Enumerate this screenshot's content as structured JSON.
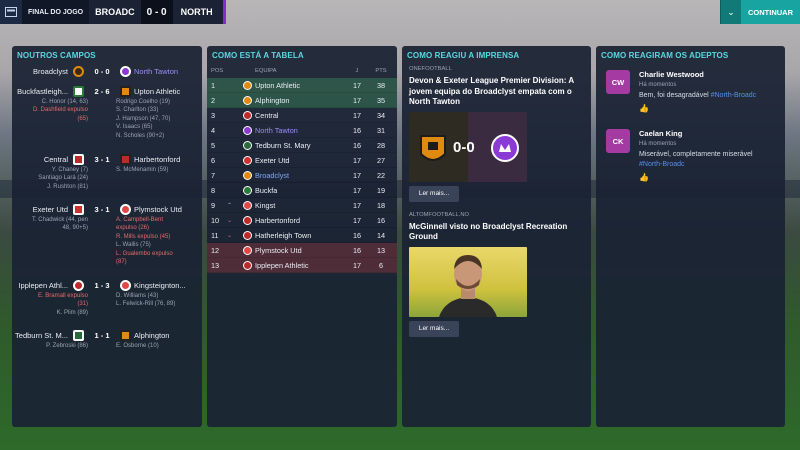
{
  "topbar": {
    "match_label": "FINAL DO JOGO",
    "home_team": "BROADC",
    "score": "0 - 0",
    "away_team": "NORTH",
    "continue_label": "CONTINUAR",
    "accent_color": "#7b2fd0",
    "continue_color": "#18a5a2"
  },
  "other_games": {
    "title": "NOUTROS CAMPOS",
    "matches": [
      {
        "home": "Broadclyst",
        "score": "0 - 0",
        "away": "North Tawton",
        "home_scorers": [],
        "away_scorers": []
      },
      {
        "home": "Buckfastleigh...",
        "score": "2 - 6",
        "away": "Upton Athletic",
        "home_scorers": [
          "C. Honor (14, 63)",
          "D. Dashfield expulso",
          "(65)"
        ],
        "away_scorers": [
          "Rodrigo Coelho (19)",
          "S. Charlton (33)",
          "J. Hampson (47, 70)",
          "V. Isaacs (65)",
          "N. Scholes (90+2)"
        ]
      },
      {
        "home": "Central",
        "score": "3 - 1",
        "away": "Harbertonford",
        "home_scorers": [
          "Y. Chaney (7)",
          "Santiago Lará (24)",
          "J. Rushton (81)"
        ],
        "away_scorers": [
          "S. McMenamin (59)"
        ]
      },
      {
        "home": "Exeter Utd",
        "score": "3 - 1",
        "away": "Plymstock Utd",
        "home_scorers": [
          "T. Chadwick (44, pen",
          "48, 90+5)"
        ],
        "away_scorers": [
          "A. Campbell-Bent",
          "expulso (26)",
          "R. Mills expulso (45)",
          "L. Wallis (75)",
          "L. Gualembo expulso",
          "(87)"
        ]
      },
      {
        "home": "Ipplepen Athl...",
        "score": "1 - 3",
        "away": "Kingsteignton...",
        "home_scorers": [
          "E. Bramall expulso",
          "(31)",
          "K. Plim (89)"
        ],
        "away_scorers": [
          "D. Williams (43)",
          "L. Felwick-Rill (76, 89)"
        ]
      },
      {
        "home": "Tedburn St. M...",
        "score": "1 - 1",
        "away": "Alphington",
        "home_scorers": [
          "P. Zebroski (86)"
        ],
        "away_scorers": [
          "E. Osborne (10)"
        ]
      }
    ]
  },
  "table": {
    "title": "COMO ESTÁ A TABELA",
    "headers": {
      "pos": "POS",
      "team": "EQUIPA",
      "j": "J",
      "pts": "PTS"
    },
    "rows": [
      {
        "pos": "1",
        "arrow": "",
        "team": "Upton Athletic",
        "j": "17",
        "pts": "38"
      },
      {
        "pos": "2",
        "arrow": "",
        "team": "Alphington",
        "j": "17",
        "pts": "35"
      },
      {
        "pos": "3",
        "arrow": "",
        "team": "Central",
        "j": "17",
        "pts": "34"
      },
      {
        "pos": "4",
        "arrow": "",
        "team": "North Tawton",
        "j": "16",
        "pts": "31"
      },
      {
        "pos": "5",
        "arrow": "",
        "team": "Tedburn St. Mary",
        "j": "16",
        "pts": "28"
      },
      {
        "pos": "6",
        "arrow": "",
        "team": "Exeter Utd",
        "j": "17",
        "pts": "27"
      },
      {
        "pos": "7",
        "arrow": "",
        "team": "Broadclyst",
        "j": "17",
        "pts": "22"
      },
      {
        "pos": "8",
        "arrow": "",
        "team": "Buckfa",
        "j": "17",
        "pts": "19"
      },
      {
        "pos": "9",
        "arrow": "^",
        "team": "Kingst",
        "j": "17",
        "pts": "18"
      },
      {
        "pos": "10",
        "arrow": "v",
        "team": "Harbertonford",
        "j": "17",
        "pts": "16"
      },
      {
        "pos": "11",
        "arrow": "v",
        "team": "Hatherleigh Town",
        "j": "16",
        "pts": "14"
      },
      {
        "pos": "12",
        "arrow": "",
        "team": "Plymstock Utd",
        "j": "16",
        "pts": "13"
      },
      {
        "pos": "13",
        "arrow": "",
        "team": "Ipplepen Athletic",
        "j": "17",
        "pts": "6"
      }
    ]
  },
  "press": {
    "title": "COMO REAGIU A IMPRENSA",
    "articles": [
      {
        "source": "ONEFOOTBALL",
        "headline": "Devon & Exeter League Premier Division: A jovem equipa do Broadclyst empata com o North Tawton",
        "image_score": "0-0",
        "more_label": "Ler mais..."
      },
      {
        "source": "ALTOMFOOTBALL.NO",
        "headline": "McGinnell visto no Broadclyst Recreation Ground",
        "more_label": "Ler mais..."
      }
    ]
  },
  "fans": {
    "title": "COMO REAGIRAM OS ADEPTOS",
    "posts": [
      {
        "initials": "CW",
        "name": "Charlie Westwood",
        "time": "Há momentos",
        "text": "Bem, foi desagradável",
        "tag": "#North-Broadc",
        "like_icon": "thumbs-up-icon"
      },
      {
        "initials": "CK",
        "name": "Caelan King",
        "time": "Há momentos",
        "text": "Miserável, completamente miserável",
        "tag": "#North-Broadc",
        "like_icon": "thumbs-up-icon"
      }
    ]
  }
}
